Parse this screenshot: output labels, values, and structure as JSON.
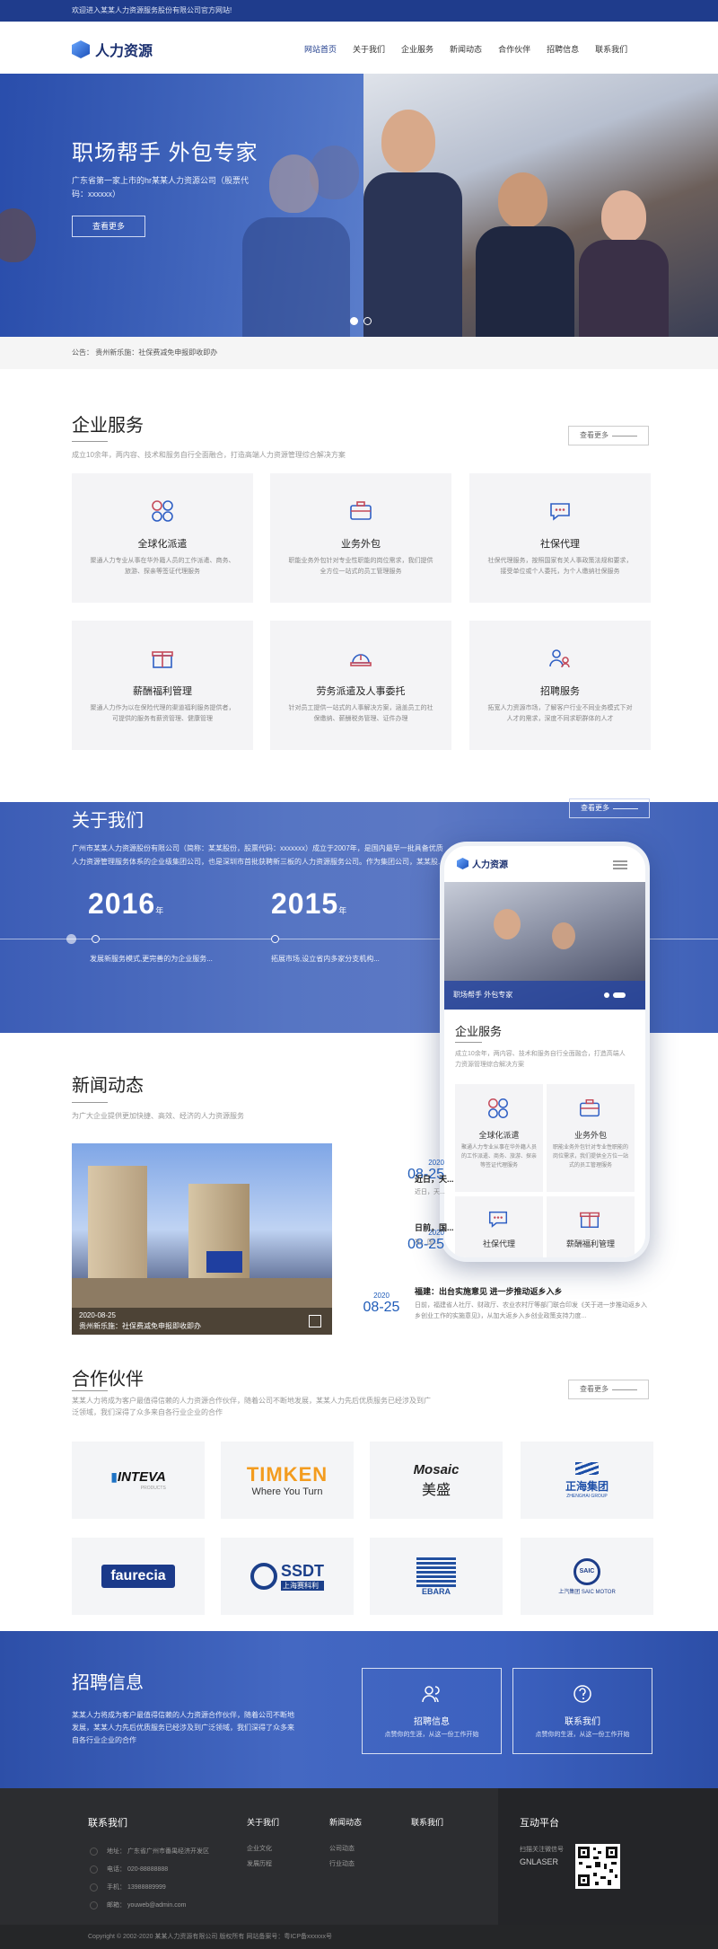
{
  "topbar": {
    "welcome": "欢迎进入某某人力资源服务股份有限公司官方网站!"
  },
  "brand": {
    "logo_text": "人力资源"
  },
  "nav": [
    "网站首页",
    "关于我们",
    "企业服务",
    "新闻动态",
    "合作伙伴",
    "招聘信息",
    "联系我们"
  ],
  "hero": {
    "title": "职场帮手 外包专家",
    "subtitle": "广东省第一家上市的hr某某人力资源公司（股票代码：xxxxxx）",
    "button": "查看更多"
  },
  "notice": {
    "label": "公告：",
    "text": "贵州新乐施：社保费减免申报即收即办"
  },
  "services": {
    "title": "企业服务",
    "desc": "成立10余年，两内容、技术和服务自行全面融合，打造高端人力资源管理综合解决方案",
    "more": "查看更多",
    "items": [
      {
        "name": "全球化派遣",
        "desc": "聚通人力专业从事在华外籍人员的工作派遣、商务、旅游、探亲等签证代理服务",
        "icon": "globe-network-icon"
      },
      {
        "name": "业务外包",
        "desc": "职能业务外包针对专业性职能的岗位需求，我们提供全方位一站式的员工管理服务",
        "icon": "briefcase-icon"
      },
      {
        "name": "社保代理",
        "desc": "社保代理服务，按照国家有关人事政策法规和要求，接受单位或个人委托，为个人缴纳社保服务",
        "icon": "chat-bubble-icon"
      },
      {
        "name": "薪酬福利管理",
        "desc": "聚通人力作为以在保险代理的渠道福利服务提供者，可提供的服务有薪资管理、健康管理",
        "icon": "gift-icon"
      },
      {
        "name": "劳务派遣及人事委托",
        "desc": "针对员工提供一站式的人事解决方案，涵盖员工的社保缴纳、薪酬税务管理、证件办理",
        "icon": "helmet-icon"
      },
      {
        "name": "招聘服务",
        "desc": "拓宽人力资源市场，了解客户行业不同业务模式下对人才的需求，深度不同求职群体的人才",
        "icon": "people-icon"
      }
    ]
  },
  "about": {
    "title": "关于我们",
    "more": "查看更多",
    "text": "广州市某某人力资源股份有限公司（简称：某某股份，股票代码：xxxxxxx）成立于2007年，是国内最早一批具备优质人力资源管理服务体系的企业级集团公司，也是深圳市首批获聘新三板的人力资源服务公司。作为集团公司，某某股...",
    "timeline": [
      {
        "year": "2016",
        "unit": "年",
        "text": "发展新服务模式,更完善的为企业服务..."
      },
      {
        "year": "2015",
        "unit": "年",
        "text": "拓展市场,设立省内多家分支机构..."
      }
    ]
  },
  "phone": {
    "logo_text": "人力资源",
    "banner_caption": "职场帮手 外包专家",
    "section_title": "企业服务",
    "section_desc": "成立10余年，两内容、技术和服务自行全面融合，打造高端人力资源管理综合解决方案",
    "cards": [
      {
        "name": "全球化派遣",
        "desc": "聚通人力专业从事在华外籍人员的工作派遣、商务、旅游、探亲等签证代理服务"
      },
      {
        "name": "业务外包",
        "desc": "职能业务外包针对专业性职能的岗位需求，我们提供全方位一站式的员工管理服务"
      },
      {
        "name": "社保代理",
        "desc": ""
      },
      {
        "name": "薪酬福利管理",
        "desc": ""
      }
    ]
  },
  "news": {
    "title": "新闻动态",
    "desc": "为广大企业提供更加快捷、高效、经济的人力资源服务",
    "image_caption_date": "2020-08-25",
    "image_caption": "贵州新乐施：社保费减免申报即收即办",
    "items": [
      {
        "year": "2020",
        "day": "08-25",
        "title": "近日，天...",
        "desc": "近日，天..."
      },
      {
        "year": "2020",
        "day": "08-25",
        "title": "日前，国...",
        "desc": "社，国..."
      },
      {
        "year": "2020",
        "day": "08-25",
        "title": "福建：出台实施意见 进一步推动返乡入乡",
        "desc": "日前，福建省人社厅、财政厅、农业农村厅等部门联合印发《关于进一步推动返乡入乡创业工作的实施意见》，从加大返乡入乡创业政策支持力度..."
      }
    ]
  },
  "partners": {
    "title": "合作伙伴",
    "desc": "某某人力将成为客户最值得信赖的人力资源合作伙伴，随着公司不断地发展，某某人力先后优质服务已经涉及到广泛领域，我们深得了众多来自各行业企业的合作",
    "more": "查看更多",
    "logos": [
      {
        "main": "INTEVA",
        "sub": "PRODUCTS"
      },
      {
        "main": "TIMKEN",
        "sub": "Where You Turn"
      },
      {
        "main": "Mosaic",
        "sub": "美盛"
      },
      {
        "main": "正海集团",
        "sub": "ZHENGHAI GROUP"
      },
      {
        "main": "faurecia",
        "sub": ""
      },
      {
        "main": "SSDT",
        "sub": "上海赛科利"
      },
      {
        "main": "EBARA",
        "sub": ""
      },
      {
        "main": "SAIC",
        "sub": "上汽集团 SAIC MOTOR"
      }
    ]
  },
  "recruit": {
    "title": "招聘信息",
    "desc": "某某人力将成为客户最值得信赖的人力资源合作伙伴，随着公司不断地发展，某某人力先后优质服务已经涉及到广泛领域，我们深得了众多来自各行业企业的合作",
    "boxes": [
      {
        "title": "招聘信息",
        "sub": "点赞你的生涯，从这一份工作开始"
      },
      {
        "title": "联系我们",
        "sub": "点赞你的生涯，从这一份工作开始"
      }
    ]
  },
  "footer": {
    "contact_title": "联系我们",
    "contact": [
      {
        "label": "地址：",
        "value": "广东省广州市番禺经济开发区"
      },
      {
        "label": "电话：",
        "value": "020-88888888"
      },
      {
        "label": "手机：",
        "value": "13988889999"
      },
      {
        "label": "邮箱：",
        "value": "youweb@admin.com"
      }
    ],
    "cols": [
      {
        "title": "关于我们",
        "links": [
          "企业文化",
          "发展历程"
        ]
      },
      {
        "title": "新闻动态",
        "links": [
          "公司动态",
          "行业动态"
        ]
      },
      {
        "title": "联系我们",
        "links": []
      }
    ],
    "platform_title": "互动平台",
    "platform_text": "扫描关注微信号",
    "platform_name": "GNLASER",
    "copyright": "Copyright © 2002-2020 某某人力资源有限公司 版权所有 网站备案号：粤ICP备xxxxxx号"
  }
}
